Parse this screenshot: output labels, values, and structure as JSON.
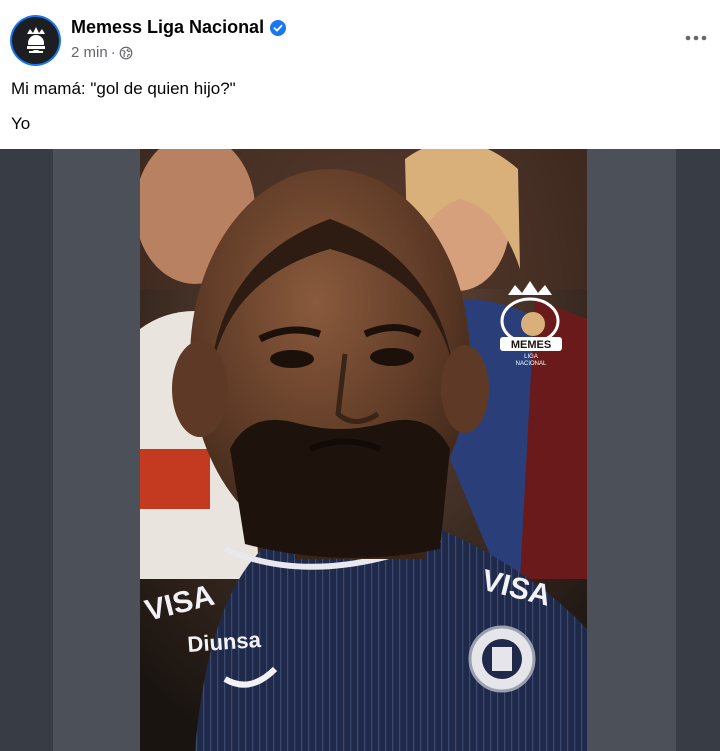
{
  "post": {
    "page_name": "Memess Liga Nacional",
    "time": "2 min",
    "separator": "·",
    "caption_line1": "Mi mamá: \"gol de quien hijo?\"",
    "caption_line2": "Yo"
  },
  "media": {
    "watermark_lines": [
      "MEMES",
      "LIGA",
      "NACIONAL"
    ],
    "jersey_text": [
      "VISA",
      "VISA",
      "Diunsa"
    ]
  },
  "colors": {
    "verified": "#1877f2",
    "text_primary": "#050505",
    "text_secondary": "#65676b",
    "media_bg": "#383c44",
    "jersey": "#1f2a4a"
  },
  "icons": [
    "verified-badge-icon",
    "globe-icon",
    "more-options-icon",
    "page-logo-icon"
  ]
}
